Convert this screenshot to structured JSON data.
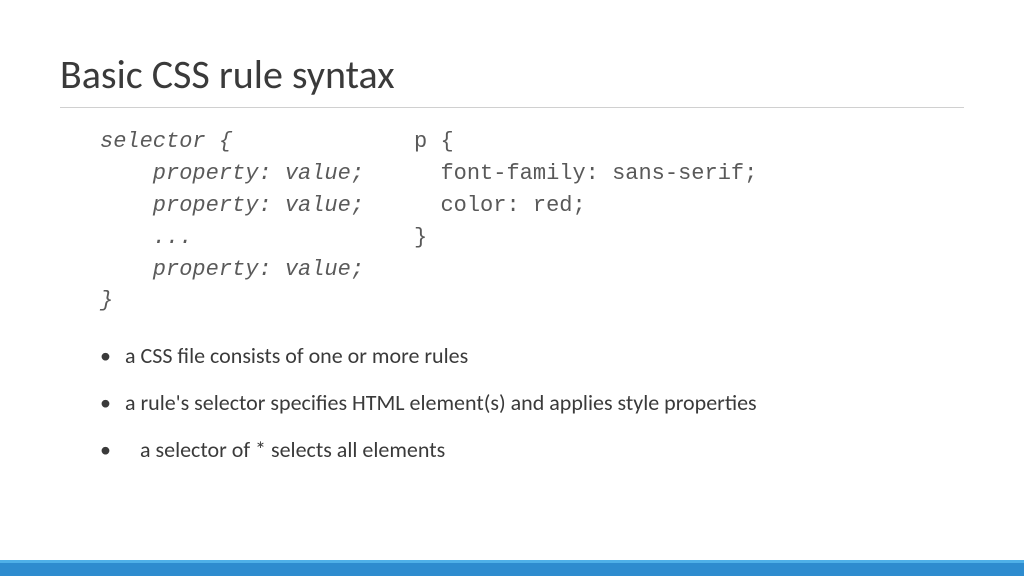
{
  "title": "Basic CSS rule syntax",
  "code": {
    "left": "selector {\n    property: value;\n    property: value;\n    ...\n    property: value;\n}",
    "right": "p {\n  font-family: sans-serif;\n  color: red;\n}"
  },
  "bullets": [
    "a CSS file consists of one or more rules",
    "a rule's selector specifies HTML element(s) and applies style properties",
    "a selector of * selects all elements"
  ],
  "colors": {
    "footer": "#2e8ccf",
    "footer_top": "#4fb0e8"
  }
}
